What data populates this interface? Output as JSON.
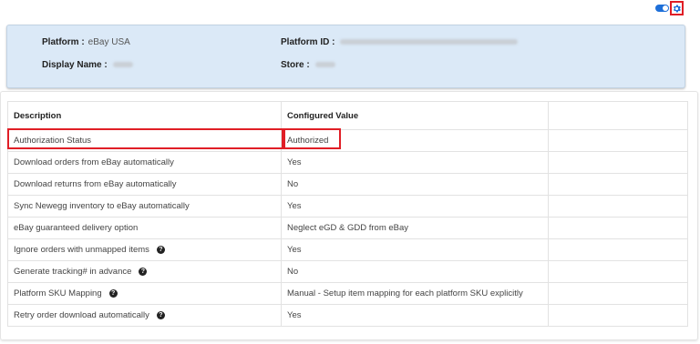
{
  "header": {
    "toggle_state": "on",
    "settings_icon": "gear-icon",
    "accent_color": "#1e6fd9",
    "highlight_color": "#e01e26"
  },
  "platform_info": {
    "platform_label": "Platform :",
    "platform_value": "eBay USA",
    "platform_id_label": "Platform ID :",
    "display_name_label": "Display Name :",
    "store_label": "Store :"
  },
  "table": {
    "headers": [
      "Description",
      "Configured Value",
      ""
    ],
    "rows": [
      {
        "description": "Authorization Status",
        "value": "Authorized",
        "help": false
      },
      {
        "description": "Download orders from eBay automatically",
        "value": "Yes",
        "help": false
      },
      {
        "description": "Download returns from eBay automatically",
        "value": "No",
        "help": false
      },
      {
        "description": "Sync Newegg inventory to eBay automatically",
        "value": "Yes",
        "help": false
      },
      {
        "description": "eBay guaranteed delivery option",
        "value": "Neglect eGD & GDD from eBay",
        "help": false
      },
      {
        "description": "Ignore orders with unmapped items",
        "value": "Yes",
        "help": true
      },
      {
        "description": "Generate tracking# in advance",
        "value": "No",
        "help": true
      },
      {
        "description": "Platform SKU Mapping",
        "value": "Manual - Setup item mapping for each platform SKU explicitly",
        "help": true
      },
      {
        "description": "Retry order download automatically",
        "value": "Yes",
        "help": true
      }
    ]
  }
}
